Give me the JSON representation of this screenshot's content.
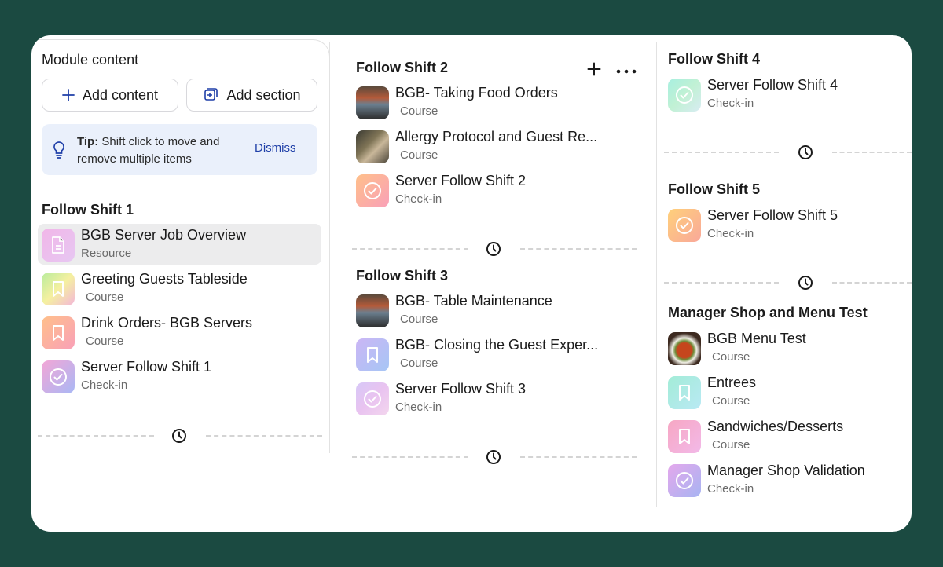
{
  "column1": {
    "title": "Module content",
    "add_content_label": "Add content",
    "add_section_label": "Add section",
    "tip": {
      "label": "Tip:",
      "text": " Shift click to move and remove multiple items",
      "dismiss": "Dismiss"
    },
    "section": {
      "title": "Follow Shift 1",
      "items": [
        {
          "name": "BGB Server Job Overview",
          "type": "Resource",
          "icon": "document-icon"
        },
        {
          "name": "Greeting Guests Tableside",
          "type": "Course",
          "icon": "bookmark-icon"
        },
        {
          "name": "Drink Orders- BGB Servers",
          "type": "Course",
          "icon": "bookmark-icon"
        },
        {
          "name": "Server Follow Shift 1",
          "type": "Check-in",
          "icon": "check-circle-icon"
        }
      ]
    }
  },
  "column2": {
    "sections": [
      {
        "title": "Follow Shift 2",
        "items": [
          {
            "name": "BGB- Taking Food Orders",
            "type": "Course",
            "icon": "photo-thumbnail"
          },
          {
            "name": "Allergy Protocol and Guest Re...",
            "type": "Course",
            "icon": "photo-thumbnail"
          },
          {
            "name": "Server Follow Shift 2",
            "type": "Check-in",
            "icon": "check-circle-icon"
          }
        ]
      },
      {
        "title": "Follow Shift 3",
        "items": [
          {
            "name": "BGB- Table Maintenance",
            "type": "Course",
            "icon": "photo-thumbnail"
          },
          {
            "name": "BGB- Closing the Guest Exper...",
            "type": "Course",
            "icon": "bookmark-icon"
          },
          {
            "name": "Server Follow Shift 3",
            "type": "Check-in",
            "icon": "check-circle-icon"
          }
        ]
      }
    ]
  },
  "column3": {
    "sections": [
      {
        "title": "Follow Shift 4",
        "items": [
          {
            "name": "Server Follow Shift 4",
            "type": "Check-in",
            "icon": "check-circle-icon"
          }
        ]
      },
      {
        "title": "Follow Shift 5",
        "items": [
          {
            "name": "Server Follow Shift 5",
            "type": "Check-in",
            "icon": "check-circle-icon"
          }
        ]
      },
      {
        "title": "Manager Shop and Menu Test",
        "items": [
          {
            "name": "BGB Menu Test",
            "type": "Course",
            "icon": "photo-thumbnail"
          },
          {
            "name": "Entrees",
            "type": "Course",
            "icon": "bookmark-icon"
          },
          {
            "name": "Sandwiches/Desserts",
            "type": "Course",
            "icon": "bookmark-icon"
          },
          {
            "name": "Manager Shop Validation",
            "type": "Check-in",
            "icon": "check-circle-icon"
          }
        ]
      }
    ]
  },
  "colors": {
    "background": "#1b4a41",
    "card": "#ffffff",
    "tip_bg": "#eaf0fb",
    "accent": "#1f3fa8",
    "selected": "#ececed"
  }
}
